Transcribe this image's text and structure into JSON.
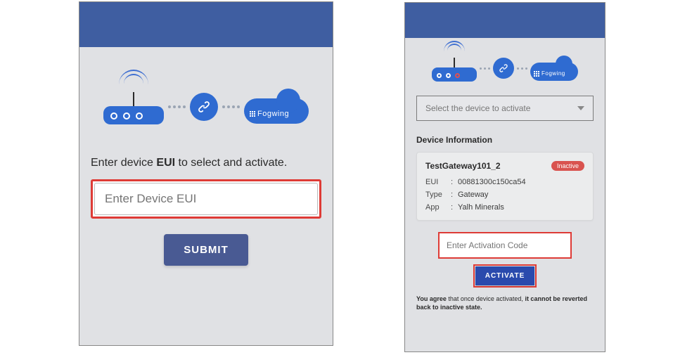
{
  "brand": {
    "name": "Fogwing"
  },
  "left": {
    "instruction_pre": "Enter device ",
    "instruction_bold": "EUI",
    "instruction_post": " to select and activate.",
    "eui_placeholder": "Enter Device EUI",
    "submit_label": "SUBMIT"
  },
  "right": {
    "select_placeholder": "Select the device to activate",
    "section_title": "Device Information",
    "device": {
      "name": "TestGateway101_2",
      "status": "Inactive",
      "fields": {
        "eui_label": "EUI",
        "eui_value": "00881300c150ca54",
        "type_label": "Type",
        "type_value": "Gateway",
        "app_label": "App",
        "app_value": "Yalh Minerals"
      }
    },
    "activation_placeholder": "Enter Activation Code",
    "activate_label": "ACTIVATE",
    "disclaimer_pre": "You agree ",
    "disclaimer_mid": "that once device activated, ",
    "disclaimer_bold2": "it cannot be reverted back to inactive state."
  }
}
